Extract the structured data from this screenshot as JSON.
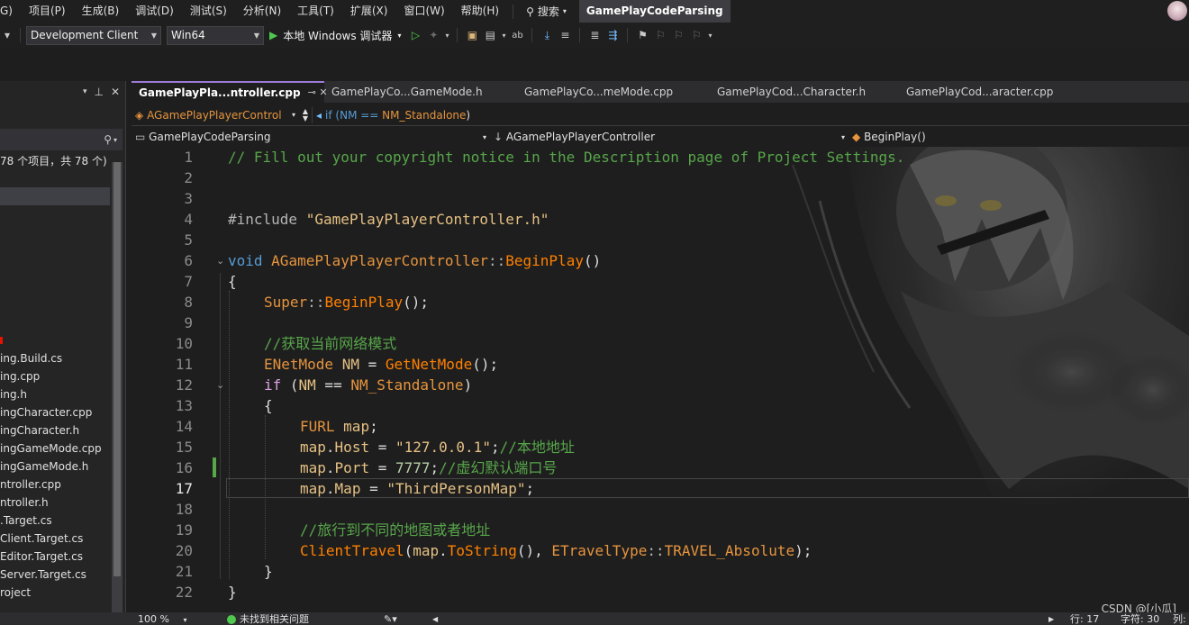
{
  "menu": {
    "items": [
      "G)",
      "项目(P)",
      "生成(B)",
      "调试(D)",
      "测试(S)",
      "分析(N)",
      "工具(T)",
      "扩展(X)",
      "窗口(W)",
      "帮助(H)"
    ],
    "search_label": "搜索",
    "solution_name": "GamePlayCodeParsing"
  },
  "toolbar": {
    "configuration": "Development Client",
    "platform": "Win64",
    "run_label": "本地 Windows 调试器"
  },
  "solution_explorer": {
    "status_text": "78 个项目，共 78 个)",
    "files": [
      "ing.Build.cs",
      "ing.cpp",
      "ing.h",
      "ingCharacter.cpp",
      "ingCharacter.h",
      "ingGameMode.cpp",
      "ingGameMode.h",
      "ntroller.cpp",
      "ntroller.h",
      ".Target.cs",
      "Client.Target.cs",
      "Editor.Target.cs",
      "Server.Target.cs",
      "roject"
    ]
  },
  "tabs": [
    {
      "label": "GamePlayPla...ntroller.cpp",
      "active": true
    },
    {
      "label": "GamePlayCo...GameMode.h",
      "active": false
    },
    {
      "label": "GamePlayCo...meMode.cpp",
      "active": false
    },
    {
      "label": "GamePlayCod...Character.h",
      "active": false
    },
    {
      "label": "GamePlayCod...aracter.cpp",
      "active": false
    }
  ],
  "nav": {
    "scope": "AGamePlayPlayerControl",
    "condition_prefix": "if (NM == ",
    "condition_enum": "NM_Standalone",
    "condition_suffix": ")",
    "project": "GamePlayCodeParsing",
    "class": "AGamePlayPlayerController",
    "member": "BeginPlay()"
  },
  "code": {
    "line_numbers": [
      "1",
      "2",
      "3",
      "4",
      "5",
      "6",
      "7",
      "8",
      "9",
      "10",
      "11",
      "12",
      "13",
      "14",
      "15",
      "16",
      "17",
      "18",
      "19",
      "20",
      "21",
      "22"
    ],
    "current_line": "17",
    "l1": "// Fill out your copyright notice in the Description page of Project Settings.",
    "l4_directive": "#include ",
    "l4_str": "\"GamePlayPlayerController.h\"",
    "l6_kw": "void",
    "l6_class": "AGamePlayPlayerController",
    "l6_sep": "::",
    "l6_func": "BeginPlay",
    "l6_parens": "()",
    "l7": "{",
    "l8_class": "Super",
    "l8_sep": "::",
    "l8_func": "BeginPlay",
    "l8_rest": "();",
    "l10": "//获取当前网络模式",
    "l11_type": "ENetMode",
    "l11_var": "NM",
    "l11_eq": " = ",
    "l11_func": "GetNetMode",
    "l11_rest": "();",
    "l12_kw": "if",
    "l12_open": " (",
    "l12_var": "NM",
    "l12_op": " == ",
    "l12_enum": "NM_Standalone",
    "l12_close": ")",
    "l13": "{",
    "l14_type": "FURL",
    "l14_var": "map",
    "l14_end": ";",
    "l15_var": "map",
    "l15_dot": ".",
    "l15_prop": "Host",
    "l15_eq": " = ",
    "l15_str": "\"127.0.0.1\"",
    "l15_end": ";",
    "l15_comment": "//本地地址",
    "l16_var": "map",
    "l16_dot": ".",
    "l16_prop": "Port",
    "l16_eq": " = ",
    "l16_num": "7777",
    "l16_end": ";",
    "l16_comment": "//虚幻默认端口号",
    "l17_var": "map",
    "l17_dot": ".",
    "l17_prop": "Map",
    "l17_eq": " = ",
    "l17_str": "\"ThirdPersonMap\"",
    "l17_end": ";",
    "l19": "//旅行到不同的地图或者地址",
    "l20_func": "ClientTravel",
    "l20_open": "(",
    "l20_var": "map",
    "l20_dot": ".",
    "l20_method": "ToString",
    "l20_mid": "(), ",
    "l20_type": "ETravelType",
    "l20_sep": "::",
    "l20_enum": "TRAVEL_Absolute",
    "l20_end": ");",
    "l21": "}",
    "l22": "}"
  },
  "watermark": "CSDN @[小瓜]",
  "status": {
    "zoom": "100 %",
    "issues": "未找到相关问题",
    "line": "行: 17",
    "char": "字符: 30",
    "col": "列:"
  },
  "colors": {
    "accent_tab": "#9a7ad6",
    "comment": "#57a64a",
    "keyword": "#569cd6",
    "type": "#e6943e",
    "string": "#e6c184"
  }
}
